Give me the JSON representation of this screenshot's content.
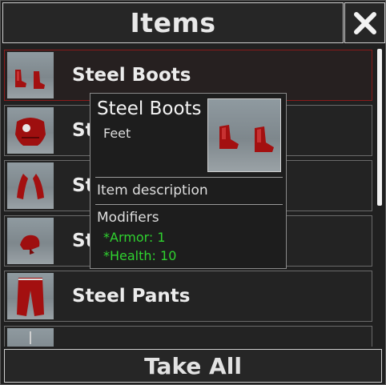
{
  "window": {
    "title": "Items",
    "close_icon": "close-icon"
  },
  "items": [
    {
      "label": "Steel Boots",
      "icon": "boots-icon",
      "selected": true
    },
    {
      "label": "St",
      "icon": "chestplate-icon"
    },
    {
      "label": "St",
      "icon": "gauntlets-icon"
    },
    {
      "label": "St",
      "icon": "helmet-icon"
    },
    {
      "label": "Steel Pants",
      "icon": "pants-icon"
    },
    {
      "label": "",
      "icon": "sword-icon"
    }
  ],
  "footer": {
    "take_all_label": "Take All"
  },
  "tooltip": {
    "name": "Steel Boots",
    "slot": "Feet",
    "description": "Item description",
    "modifiers_title": "Modifiers",
    "modifiers": [
      "*Armor: 1",
      "*Health: 10"
    ]
  },
  "colors": {
    "modifier": "#2fd22f",
    "selected_border": "#8b1a1a",
    "item_red": "#b31212"
  }
}
